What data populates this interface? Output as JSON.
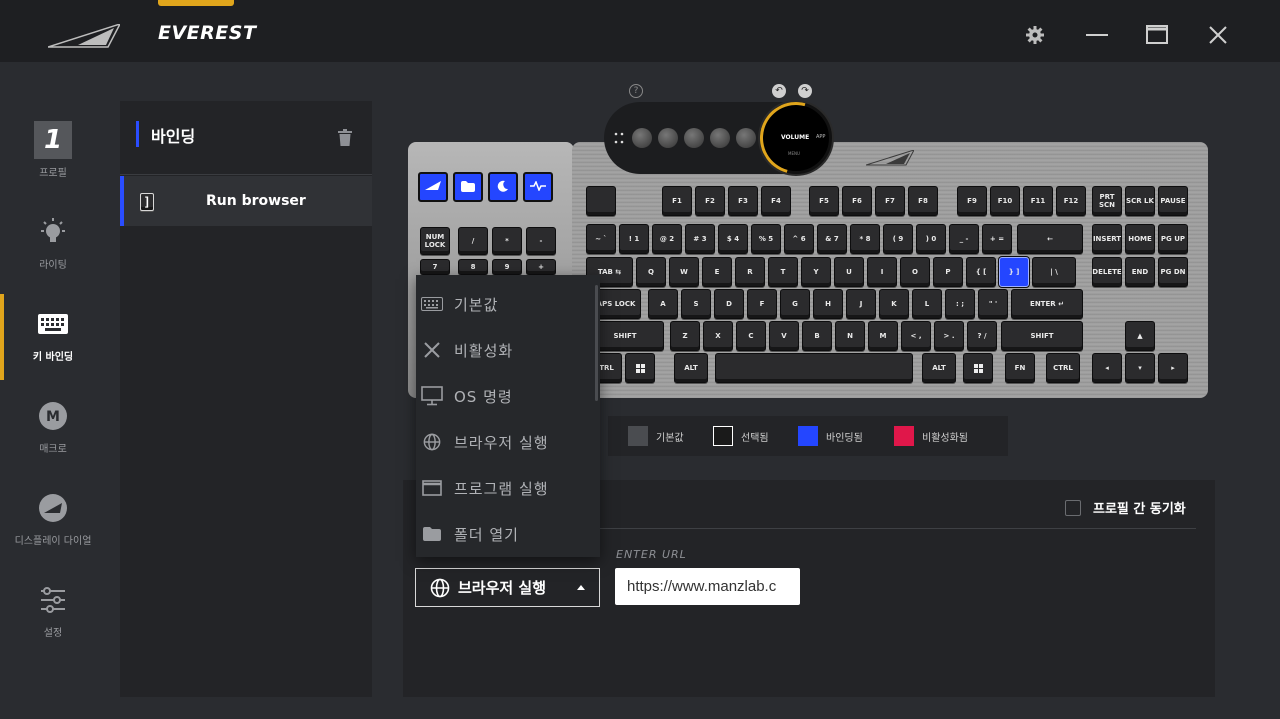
{
  "app": {
    "title": "EVEREST"
  },
  "nav": {
    "items": [
      {
        "label": "프로필",
        "profile_number": "1"
      },
      {
        "label": "라이팅"
      },
      {
        "label": "키 바인딩"
      },
      {
        "label": "매크로"
      },
      {
        "label": "디스플레이 다이얼"
      },
      {
        "label": "설정"
      }
    ],
    "active": "키 바인딩"
  },
  "binding_panel": {
    "title": "바인딩",
    "items": [
      {
        "key": "]",
        "name": "Run browser"
      }
    ]
  },
  "dial": {
    "volume": "VOLUME",
    "app": "APP",
    "menu": "MENU"
  },
  "keyboard": {
    "row_f": [
      "F1",
      "F2",
      "F3",
      "F4",
      "F5",
      "F6",
      "F7",
      "F8",
      "F9",
      "F10",
      "F11",
      "F12"
    ],
    "nav_top": [
      "PRT SCN",
      "SCR LK",
      "PAUSE"
    ],
    "nav_mid": [
      "INSERT",
      "HOME",
      "PG UP"
    ],
    "nav_low": [
      "DELETE",
      "END",
      "PG DN"
    ],
    "numpad": [
      "NUM LOCK",
      "/",
      "*",
      "-",
      "7",
      "8",
      "9",
      "+"
    ],
    "row_num": [
      "~ `",
      "! 1",
      "@ 2",
      "# 3",
      "$ 4",
      "% 5",
      "^ 6",
      "& 7",
      "* 8",
      "( 9",
      ") 0",
      "_ -",
      "+ ="
    ],
    "backspace": "←",
    "row_q": [
      "Q",
      "W",
      "E",
      "R",
      "T",
      "Y",
      "U",
      "I",
      "O",
      "P",
      "{ [",
      "} ]",
      "| \\"
    ],
    "tab": "TAB ⇆",
    "row_a": [
      "A",
      "S",
      "D",
      "F",
      "G",
      "H",
      "J",
      "K",
      "L",
      ": ;",
      "\" '"
    ],
    "caps": "CAPS LOCK",
    "enter": "ENTER ↵",
    "row_z": [
      "Z",
      "X",
      "C",
      "V",
      "B",
      "N",
      "M",
      "< ,",
      "> .",
      "? /"
    ],
    "shift": "SHIFT",
    "ctrl": "CTRL",
    "alt": "ALT",
    "fn": "FN",
    "bound_key": "} ]"
  },
  "legend": [
    {
      "label": "기본값",
      "color": "#4a4c50"
    },
    {
      "label": "선택됨",
      "color": "#1a1a1a"
    },
    {
      "label": "바인딩됨",
      "color": "#2446ff"
    },
    {
      "label": "비활성화됨",
      "color": "#e0174a"
    }
  ],
  "settings": {
    "sync_label": "프로필 간 동기화",
    "url_label": "ENTER URL",
    "url_value": "https://www.manzlab.c"
  },
  "dropdown": {
    "selected": "브라우저 실행",
    "options": [
      {
        "label": "기본값",
        "icon": "keyboard-icon"
      },
      {
        "label": "비활성화",
        "icon": "close-icon"
      },
      {
        "label": "OS 명령",
        "icon": "monitor-icon"
      },
      {
        "label": "브라우저 실행",
        "icon": "globe-icon"
      },
      {
        "label": "프로그램 실행",
        "icon": "window-icon"
      },
      {
        "label": "폴더 열기",
        "icon": "folder-icon"
      }
    ]
  }
}
